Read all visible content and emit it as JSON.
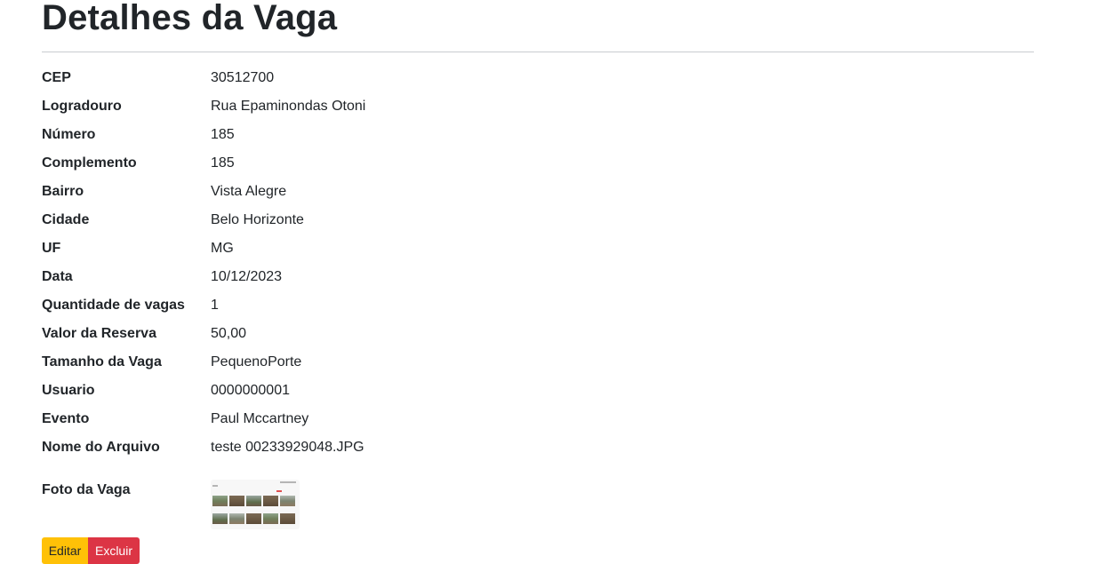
{
  "page": {
    "title": "Detalhes da Vaga"
  },
  "details": [
    {
      "label": "CEP",
      "value": "30512700"
    },
    {
      "label": "Logradouro",
      "value": "Rua Epaminondas Otoni"
    },
    {
      "label": "Número",
      "value": "185"
    },
    {
      "label": "Complemento",
      "value": "185"
    },
    {
      "label": "Bairro",
      "value": "Vista Alegre"
    },
    {
      "label": "Cidade",
      "value": "Belo Horizonte"
    },
    {
      "label": "UF",
      "value": "MG"
    },
    {
      "label": "Data",
      "value": "10/12/2023"
    },
    {
      "label": "Quantidade de vagas",
      "value": "1"
    },
    {
      "label": "Valor da Reserva",
      "value": "50,00"
    },
    {
      "label": "Tamanho da Vaga",
      "value": "PequenoPorte"
    },
    {
      "label": "Usuario",
      "value": "0000000001"
    },
    {
      "label": "Evento",
      "value": "Paul Mccartney"
    },
    {
      "label": "Nome do Arquivo",
      "value": "teste 00233929048.JPG"
    }
  ],
  "photo": {
    "label": "Foto da Vaga"
  },
  "actions": {
    "edit_label": "Editar",
    "delete_label": "Excluir"
  },
  "colors": {
    "edit_button": "#ffc107",
    "delete_button": "#dc3545",
    "text": "#212529"
  }
}
